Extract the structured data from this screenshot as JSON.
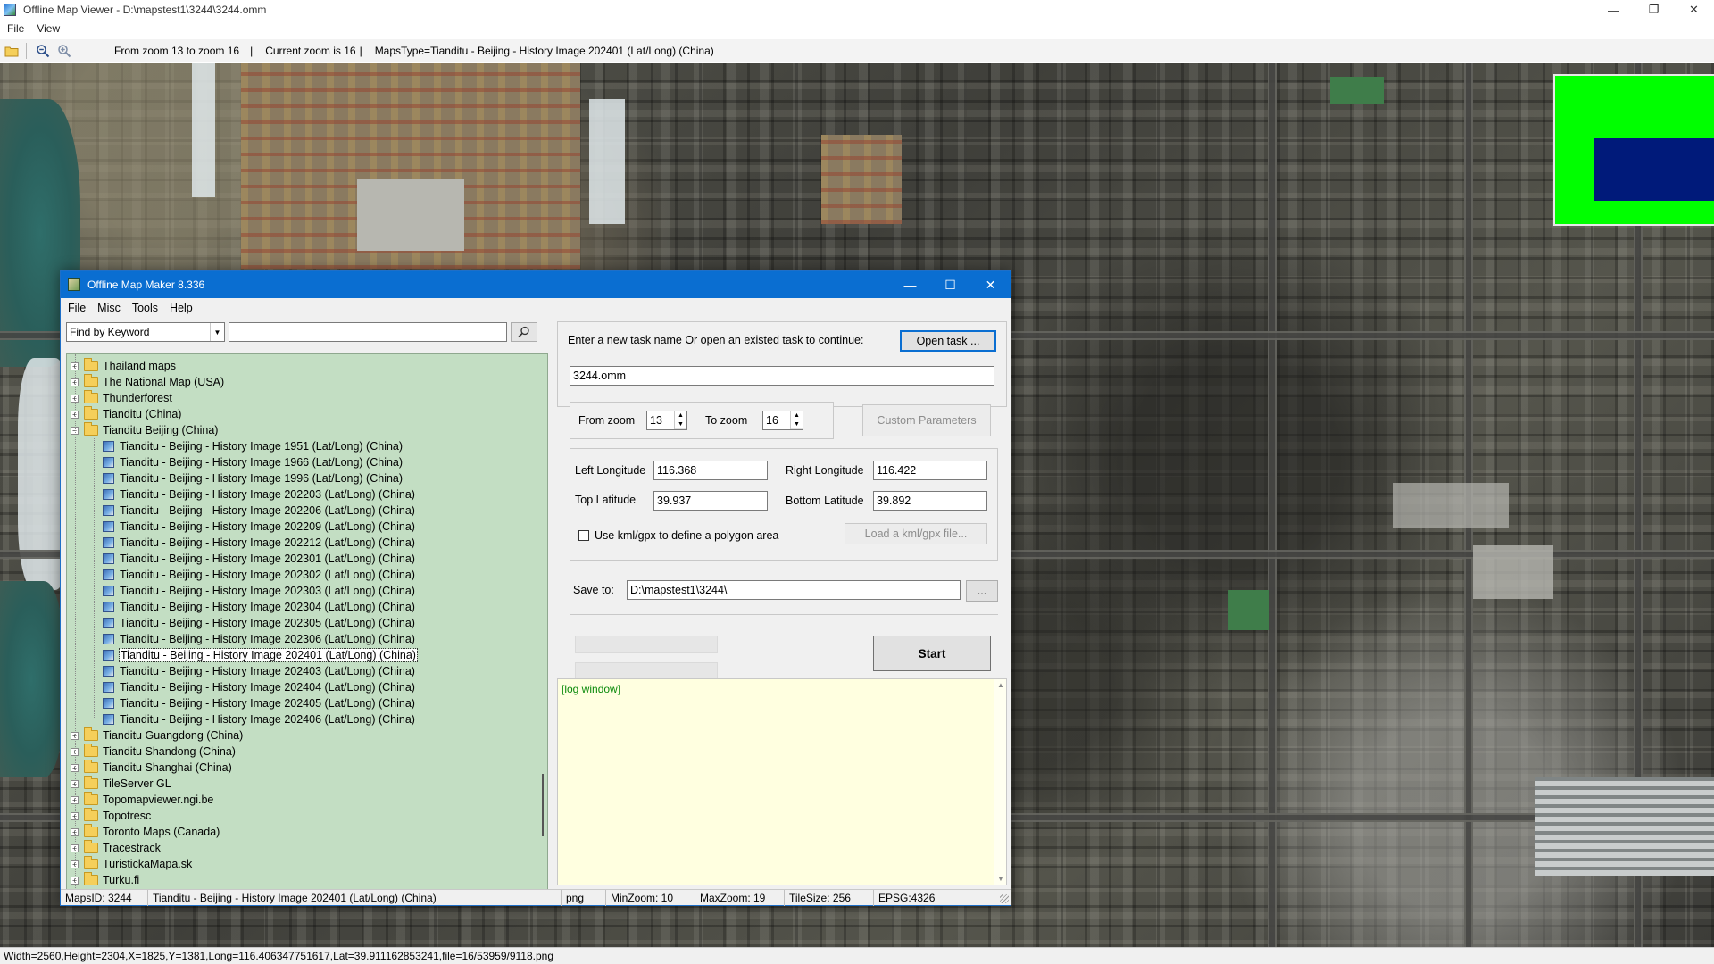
{
  "viewer": {
    "title": "Offline Map Viewer - D:\\mapstest1\\3244\\3244.omm",
    "window_controls": [
      "—",
      "❐",
      "✕"
    ],
    "menu": [
      "File",
      "View"
    ],
    "toolbar": {
      "zoom_range": "From zoom 13 to zoom 16",
      "current_zoom": "Current zoom is 16",
      "maps_type": "MapsType=Tianditu - Beijing - History Image 202401 (Lat/Long) (China)"
    },
    "status": "Width=2560,Height=2304,X=1825,Y=1381,Long=116.406347751617,Lat=39.911162853241,file=16/53959/9118.png",
    "overview_colors": {
      "background": "#00ff00",
      "viewport": "#001a7a"
    }
  },
  "dialog": {
    "title": "Offline Map Maker 8.336",
    "window_controls": [
      "—",
      "☐",
      "✕"
    ],
    "menu": [
      "File",
      "Misc",
      "Tools",
      "Help"
    ],
    "find_by": "Find by Keyword",
    "keyword": "",
    "tree": [
      {
        "label": "Thailand maps",
        "kind": "folder",
        "expander": "+"
      },
      {
        "label": "The National Map (USA)",
        "kind": "folder",
        "expander": "+"
      },
      {
        "label": "Thunderforest",
        "kind": "folder",
        "expander": "+"
      },
      {
        "label": "Tianditu (China)",
        "kind": "folder",
        "expander": "+"
      },
      {
        "label": "Tianditu Beijing (China)",
        "kind": "folder-open",
        "expander": "−"
      },
      {
        "label": "Tianditu - Beijing - History Image 1951 (Lat/Long) (China)",
        "kind": "map"
      },
      {
        "label": "Tianditu - Beijing - History Image 1966 (Lat/Long) (China)",
        "kind": "map"
      },
      {
        "label": "Tianditu - Beijing - History Image 1996 (Lat/Long) (China)",
        "kind": "map"
      },
      {
        "label": "Tianditu - Beijing - History Image 202203 (Lat/Long) (China)",
        "kind": "map"
      },
      {
        "label": "Tianditu - Beijing - History Image 202206 (Lat/Long) (China)",
        "kind": "map"
      },
      {
        "label": "Tianditu - Beijing - History Image 202209 (Lat/Long) (China)",
        "kind": "map"
      },
      {
        "label": "Tianditu - Beijing - History Image 202212 (Lat/Long) (China)",
        "kind": "map"
      },
      {
        "label": "Tianditu - Beijing - History Image 202301 (Lat/Long) (China)",
        "kind": "map"
      },
      {
        "label": "Tianditu - Beijing - History Image 202302 (Lat/Long) (China)",
        "kind": "map"
      },
      {
        "label": "Tianditu - Beijing - History Image 202303 (Lat/Long) (China)",
        "kind": "map"
      },
      {
        "label": "Tianditu - Beijing - History Image 202304 (Lat/Long) (China)",
        "kind": "map"
      },
      {
        "label": "Tianditu - Beijing - History Image 202305 (Lat/Long) (China)",
        "kind": "map"
      },
      {
        "label": "Tianditu - Beijing - History Image 202306 (Lat/Long) (China)",
        "kind": "map"
      },
      {
        "label": "Tianditu - Beijing - History Image 202401 (Lat/Long) (China)",
        "kind": "map",
        "selected": true
      },
      {
        "label": "Tianditu - Beijing - History Image 202403 (Lat/Long) (China)",
        "kind": "map"
      },
      {
        "label": "Tianditu - Beijing - History Image 202404 (Lat/Long) (China)",
        "kind": "map"
      },
      {
        "label": "Tianditu - Beijing - History Image 202405 (Lat/Long) (China)",
        "kind": "map"
      },
      {
        "label": "Tianditu - Beijing - History Image 202406 (Lat/Long) (China)",
        "kind": "map"
      },
      {
        "label": "Tianditu Guangdong (China)",
        "kind": "folder",
        "expander": "+"
      },
      {
        "label": "Tianditu Shandong (China)",
        "kind": "folder",
        "expander": "+"
      },
      {
        "label": "Tianditu Shanghai (China)",
        "kind": "folder",
        "expander": "+"
      },
      {
        "label": "TileServer GL",
        "kind": "folder",
        "expander": "+"
      },
      {
        "label": "Topomapviewer.ngi.be",
        "kind": "folder",
        "expander": "+"
      },
      {
        "label": "Topotresc",
        "kind": "folder",
        "expander": "+"
      },
      {
        "label": "Toronto Maps (Canada)",
        "kind": "folder",
        "expander": "+"
      },
      {
        "label": "Tracestrack",
        "kind": "folder",
        "expander": "+"
      },
      {
        "label": "TuristickaMapa.sk",
        "kind": "folder",
        "expander": "+"
      },
      {
        "label": "Turku.fi",
        "kind": "folder",
        "expander": "+"
      }
    ],
    "task": {
      "prompt": "Enter a new task name Or open an existed task to continue:",
      "open_task_label": "Open task ...",
      "name": "3244.omm"
    },
    "zoom": {
      "from_label": "From zoom",
      "from_value": "13",
      "to_label": "To zoom",
      "to_value": "16",
      "custom_params_label": "Custom Parameters"
    },
    "bounds": {
      "left_lon_label": "Left Longitude",
      "left_lon": "116.368",
      "right_lon_label": "Right Longitude",
      "right_lon": "116.422",
      "top_lat_label": "Top Latitude",
      "top_lat": "39.937",
      "bottom_lat_label": "Bottom Latitude",
      "bottom_lat": "39.892",
      "kml_label": "Use kml/gpx to define a polygon area",
      "kml_checked": false,
      "load_kml_label": "Load a kml/gpx file..."
    },
    "save": {
      "label": "Save to:",
      "path": "D:\\mapstest1\\3244\\",
      "browse_label": "..."
    },
    "start_label": "Start",
    "log_text": "[log window]",
    "status": {
      "maps_id": "MapsID: 3244",
      "map_name": "Tianditu - Beijing - History Image 202401 (Lat/Long) (China)",
      "format": "png",
      "min_zoom": "MinZoom: 10",
      "max_zoom": "MaxZoom: 19",
      "tile_size": "TileSize: 256",
      "epsg": "EPSG:4326"
    }
  }
}
